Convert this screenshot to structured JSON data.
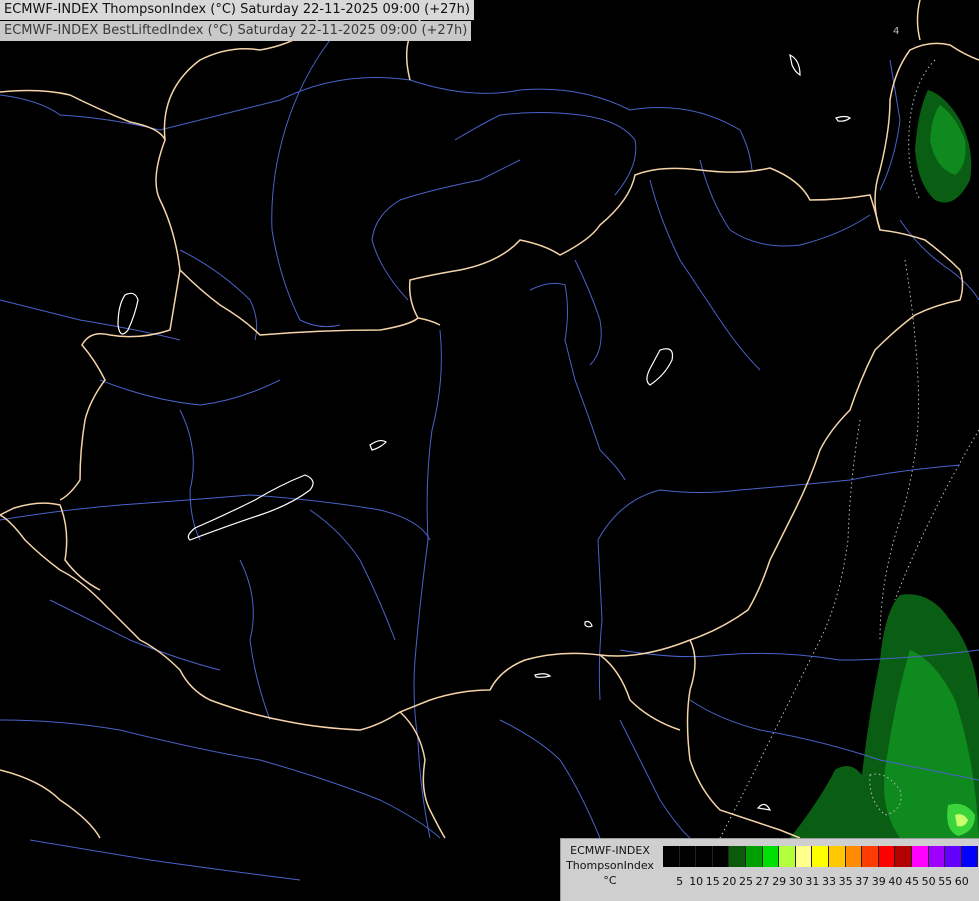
{
  "titles": {
    "line1": "ECMWF-INDEX ThompsonIndex (°C) Saturday 22-11-2025 09:00 (+27h)",
    "line2": "ECMWF-INDEX BestLiftedIndex (°C) Saturday 22-11-2025 09:00 (+27h)"
  },
  "map": {
    "background_color": "#000000",
    "border_color": "#f5d4a8",
    "river_color": "#4a63c8",
    "lake_outline_color": "#ffffff",
    "field_colors": {
      "dark_green": "#0a5e14",
      "green": "#0e8a1e",
      "light_green": "#3cd43c",
      "yellow_green": "#c8ff6a"
    },
    "contour_label": "4"
  },
  "legend": {
    "caption_line1": "ECMWF-INDEX",
    "caption_line2": "ThompsonIndex",
    "caption_line3": "°C",
    "labels": [
      "5",
      "10",
      "15",
      "20",
      "25",
      "27",
      "29",
      "30",
      "31",
      "33",
      "35",
      "37",
      "39",
      "40",
      "45",
      "50",
      "55",
      "60"
    ],
    "colors": [
      "#000000",
      "#000000",
      "#000000",
      "#000000",
      "#0a5a0a",
      "#00a000",
      "#00e000",
      "#b4ff3c",
      "#ffff8c",
      "#ffff00",
      "#ffc800",
      "#ff8c00",
      "#ff3c00",
      "#ff0000",
      "#b40000",
      "#ff00ff",
      "#a000ff",
      "#6400ff",
      "#0000ff"
    ]
  }
}
